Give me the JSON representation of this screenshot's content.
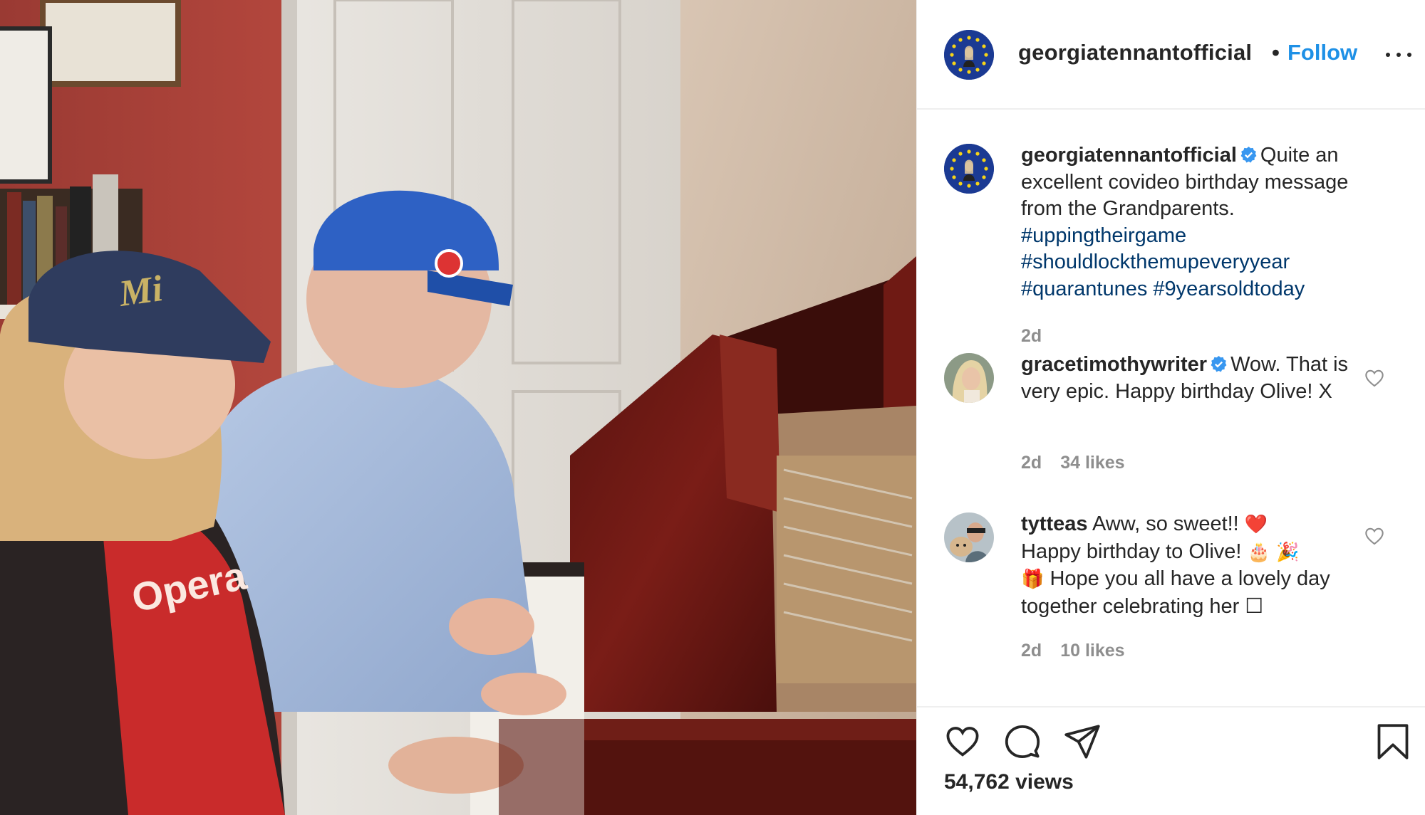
{
  "post": {
    "username": "georgiatennantofficial",
    "separator": "•",
    "follow_label": "Follow",
    "more_icon": "more-horizontal-icon"
  },
  "comments": [
    {
      "username": "georgiatennantofficial",
      "verified": true,
      "text": "Quite an excellent covideo birthday message from the Grandparents.",
      "hashtags": [
        "#uppingtheirgame",
        "#shouldlockthemupeveryyear",
        "#quarantunes #9yearsoldtoday"
      ],
      "time": "2d"
    },
    {
      "username": "gracetimothywriter",
      "verified": true,
      "text": "Wow. That is very epic. Happy birthday Olive! X",
      "time": "2d",
      "likes": "34 likes"
    },
    {
      "username": "tytteas",
      "verified": false,
      "text_1": "Aww, so sweet!!",
      "emoji_heart": "❤️",
      "text_2": "Happy birthday to Olive!",
      "emoji_cake": "🎂",
      "emoji_party": "🎉",
      "emoji_gift": "🎁",
      "text_3": "Hope you all have a lovely day together celebrating her",
      "emoji_box": "☐",
      "time": "2d",
      "likes": "10 likes"
    }
  ],
  "footer": {
    "views": "54,762 views",
    "icons": [
      "heart-icon",
      "comment-icon",
      "share-icon",
      "bookmark-icon"
    ]
  },
  "colors": {
    "link_blue": "#1e90e6",
    "hashtag": "#00376b",
    "meta_gray": "#8e8e8e",
    "border": "#efefef"
  }
}
